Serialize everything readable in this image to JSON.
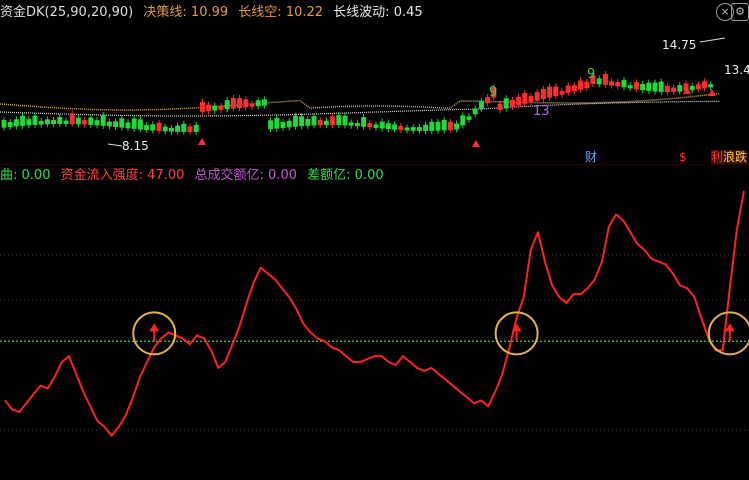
{
  "header_top": {
    "name": "资金DK(25,90,20,90)",
    "decision_label": "决策线:",
    "decision_value": "10.99",
    "long_empty_label": "长线空:",
    "long_empty_value": "10.22",
    "long_wave_label": "长线波动:",
    "long_wave_value": "0.45"
  },
  "header_bottom": {
    "curve_label": "曲:",
    "curve_value": "0.00",
    "inflow_label": "资金流入强度:",
    "inflow_value": "47.00",
    "volume_label": "总成交额亿:",
    "volume_value": "0.00",
    "diff_label": "差额亿:",
    "diff_value": "0.00"
  },
  "window_buttons": {
    "close": "×",
    "settings": "⚙"
  },
  "price_labels": {
    "high": "14.75",
    "low": "8.15",
    "right_edge": "13.4"
  },
  "markers": {
    "nine_left": "9",
    "nine_right": "9",
    "thirteen": "13",
    "cai": "财",
    "dollar": "$",
    "tag_right": "利",
    "tag_right2": "浪",
    "tag_right3": "跌"
  },
  "colors": {
    "up": "#ff2d2d",
    "down": "#22d83a",
    "ma_gold": "#d9a65b",
    "ma_white": "#dddddd",
    "signal": "#ff2222",
    "baseline": "#38c13a",
    "circle": "#e6b04a",
    "magenta": "#d04cd0",
    "purple": "#b060ff"
  },
  "chart_data": {
    "type": "line",
    "title": "",
    "xlabel": "",
    "ylabel": "",
    "baseline": 47,
    "ylim": [
      0,
      100
    ],
    "series": [
      {
        "name": "资金流入强度",
        "values": [
          27,
          24,
          23,
          26,
          29,
          32,
          31,
          35,
          40,
          42,
          36,
          30,
          25,
          20,
          18,
          15,
          18,
          22,
          28,
          35,
          40,
          45,
          48,
          50,
          49,
          48,
          46,
          49,
          48,
          44,
          38,
          40,
          46,
          52,
          60,
          67,
          72,
          70,
          68,
          65,
          62,
          58,
          53,
          50,
          48,
          47,
          45,
          44,
          42,
          40,
          40,
          41,
          42,
          42,
          40,
          39,
          42,
          40,
          38,
          37,
          38,
          36,
          34,
          32,
          30,
          28,
          26,
          27,
          25,
          30,
          36,
          45,
          55,
          62,
          78,
          84,
          74,
          66,
          62,
          60,
          63,
          63,
          65,
          68,
          74,
          86,
          90,
          88,
          84,
          80,
          78,
          75,
          74,
          73,
          70,
          66,
          65,
          62,
          55,
          48,
          44,
          44,
          65,
          85,
          98
        ]
      }
    ],
    "annotation_points": [
      21,
      72,
      102
    ]
  }
}
